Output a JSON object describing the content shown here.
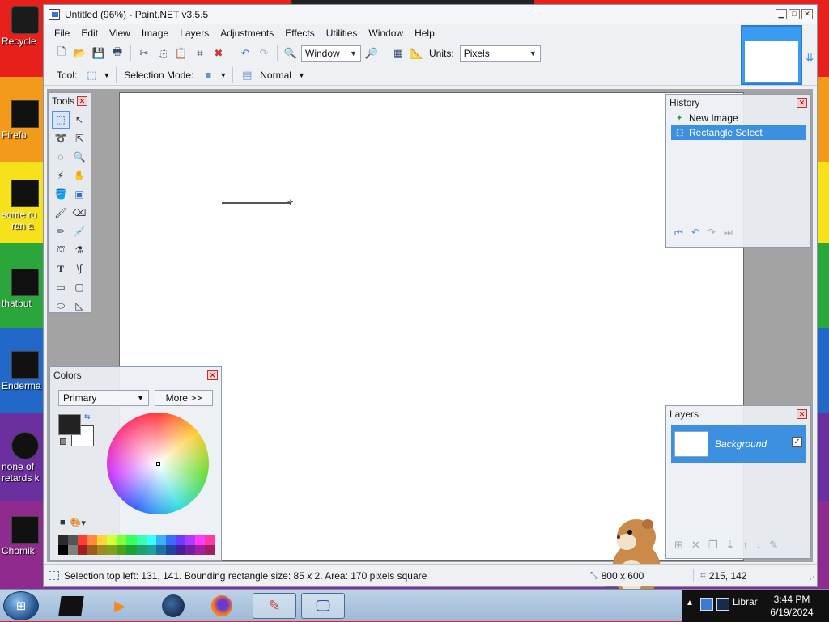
{
  "desktop": {
    "icons": [
      {
        "label": "Recycle"
      },
      {
        "label": "Firefo"
      },
      {
        "label": "some ru"
      },
      {
        "label": "ran a"
      },
      {
        "label": "thatbut"
      },
      {
        "label": "Enderma"
      },
      {
        "label": "none of"
      },
      {
        "label": "retards k"
      },
      {
        "label": "Chomik"
      }
    ]
  },
  "window": {
    "title": "Untitled (96%) - Paint.NET v3.5.5",
    "buttons": {
      "minimize": "▁",
      "maximize": "□",
      "close": "✕"
    }
  },
  "menu": [
    "File",
    "Edit",
    "View",
    "Image",
    "Layers",
    "Adjustments",
    "Effects",
    "Utilities",
    "Window",
    "Help"
  ],
  "toolbar": {
    "zoom_value": "Window",
    "units_label": "Units:",
    "units_value": "Pixels"
  },
  "toolbar2": {
    "tool_label": "Tool:",
    "selection_mode_label": "Selection Mode:",
    "blend_value": "Normal"
  },
  "tools_panel": {
    "title": "Tools"
  },
  "history_panel": {
    "title": "History",
    "items": [
      {
        "label": "New Image",
        "selected": false
      },
      {
        "label": "Rectangle Select",
        "selected": true
      }
    ]
  },
  "colors_panel": {
    "title": "Colors",
    "mode_value": "Primary",
    "more_label": "More >>",
    "primary_color": "#222222",
    "secondary_color": "#ffffff",
    "palette": [
      "#2b2b2b",
      "#555555",
      "#ff3b3b",
      "#ff8a3b",
      "#ffd43b",
      "#d6ff3b",
      "#7dff3b",
      "#3bff5a",
      "#3bffb0",
      "#3bffff",
      "#3bb0ff",
      "#3b6bff",
      "#6b3bff",
      "#b03bff",
      "#ff3bff",
      "#ff3b9e",
      "#000000",
      "#808080",
      "#a02020",
      "#a05a20",
      "#a08a20",
      "#84a020",
      "#50a020",
      "#20a038",
      "#20a070",
      "#20a0a0",
      "#2070a0",
      "#2044a0",
      "#4420a0",
      "#7020a0",
      "#a020a0",
      "#a02064"
    ]
  },
  "layers_panel": {
    "title": "Layers",
    "layer_name": "Background",
    "layer_visible": true
  },
  "statusbar": {
    "message": "Selection top left: 131, 141. Bounding rectangle size: 85 x 2. Area: 170 pixels square",
    "image_size": "800 x 600",
    "cursor_pos": "215, 142"
  },
  "taskbar": {
    "tray_text": "Librar",
    "time": "3:44 PM",
    "date": "6/19/2024"
  }
}
